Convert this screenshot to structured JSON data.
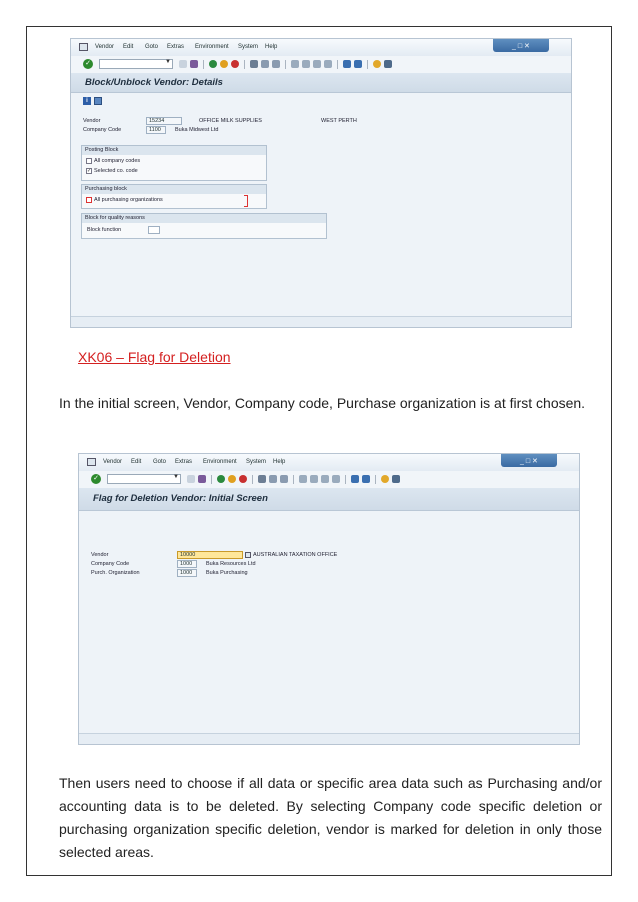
{
  "screen1": {
    "menu": [
      "Vendor",
      "Edit",
      "Goto",
      "Extras",
      "Environment",
      "System",
      "Help"
    ],
    "window_controls": "_ □ ✕",
    "title": "Block/Unblock Vendor: Details",
    "fields": {
      "vendor_label": "Vendor",
      "vendor_value": "15234",
      "vendor_name": "OFFICE MILK SUPPLIES",
      "vendor_city": "WEST PERTH",
      "company_code_label": "Company Code",
      "company_code_value": "1100",
      "company_code_name": "Buka Midwest Ltd"
    },
    "posting_block": {
      "title": "Posting Block",
      "all_company_codes": "All company codes",
      "selected_co_code": "Selected co. code"
    },
    "purchasing_block": {
      "title": "Purchasing block",
      "all_purchasing_orgs": "All purchasing organizations"
    },
    "quality_block": {
      "title": "Block for quality reasons",
      "block_function": "Block function"
    }
  },
  "heading": "XK06 – Flag for Deletion",
  "paragraph1": "In the initial screen, Vendor, Company code, Purchase organization is at first chosen.",
  "screen2": {
    "menu": [
      "Vendor",
      "Edit",
      "Goto",
      "Extras",
      "Environment",
      "System",
      "Help"
    ],
    "window_controls": "_ □ ✕",
    "title": "Flag for Deletion Vendor:  Initial Screen",
    "fields": {
      "vendor_label": "Vendor",
      "vendor_value": "10000",
      "vendor_name": "AUSTRALIAN TAXATION OFFICE",
      "company_code_label": "Company Code",
      "company_code_value": "1000",
      "company_code_name": "Buka Resources Ltd",
      "purch_org_label": "Purch. Organization",
      "purch_org_value": "1000",
      "purch_org_name": "Buka Purchasing"
    }
  },
  "paragraph2": "Then users need to choose if all data or specific area data such as Purchasing and/or accounting data is to be deleted. By selecting Company code specific deletion or purchasing organization specific deletion, vendor is marked for deletion in only those selected areas."
}
